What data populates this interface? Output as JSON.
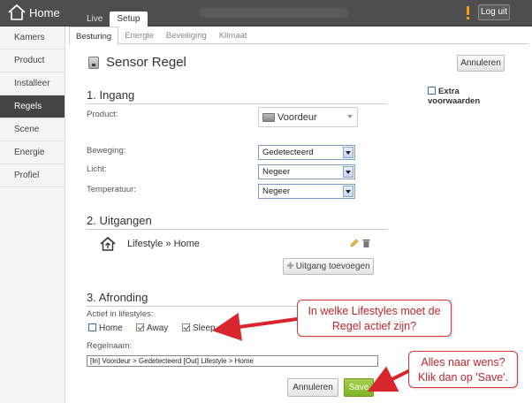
{
  "topbar": {
    "logo_label": "Home",
    "tabs": [
      {
        "label": "Live",
        "active": false
      },
      {
        "label": "Setup",
        "active": true
      }
    ],
    "logout_label": "Log uit",
    "alert_color": "#f39c12"
  },
  "sidebar": {
    "items": [
      {
        "label": "Kamers",
        "active": false
      },
      {
        "label": "Product",
        "active": false
      },
      {
        "label": "Installeer",
        "active": false
      },
      {
        "label": "Regels",
        "active": true
      },
      {
        "label": "Scene",
        "active": false
      },
      {
        "label": "Energie",
        "active": false
      },
      {
        "label": "Profiel",
        "active": false
      }
    ]
  },
  "subtabs": [
    {
      "label": "Besturing",
      "active": true
    },
    {
      "label": "Energie",
      "active": false
    },
    {
      "label": "Beveiliging",
      "active": false
    },
    {
      "label": "Klimaat",
      "active": false
    }
  ],
  "page": {
    "title": "Sensor Regel",
    "cancel_top": "Annuleren",
    "extra_label": "Extra voorwaarden",
    "extra_checked": false
  },
  "ingang": {
    "heading": "1. Ingang",
    "product_label": "Product:",
    "product_value": "Voordeur",
    "beweging_label": "Beweging:",
    "beweging_value": "Gedetecteerd",
    "licht_label": "Licht:",
    "licht_value": "Negeer",
    "temperatuur_label": "Temperatuur:",
    "temperatuur_value": "Negeer"
  },
  "uitgangen": {
    "heading": "2. Uitgangen",
    "item_label": "Lifestyle » Home",
    "add_label": "Uitgang toevoegen"
  },
  "afronding": {
    "heading": "3. Afronding",
    "lifestyles_label": "Actief in lifestyles:",
    "lifestyles": [
      {
        "label": "Home",
        "checked": false
      },
      {
        "label": "Away",
        "checked": true
      },
      {
        "label": "Sleep",
        "checked": true
      }
    ],
    "regelnaam_label": "Regelnaam:",
    "regelnaam_value": "[In] Voordeur > Gedetecteerd  [Out] Lifestyle > Home",
    "cancel_label": "Annuleren",
    "save_label": "Save",
    "save_color": "#8cbf2f"
  },
  "callouts": {
    "lifestyles_line1": "In welke Lifestyles moet de",
    "lifestyles_line2": "Regel actief zijn?",
    "save_line1": "Alles naar wens?",
    "save_line2": "Klik dan op 'Save'.",
    "color": "#d9262c"
  }
}
